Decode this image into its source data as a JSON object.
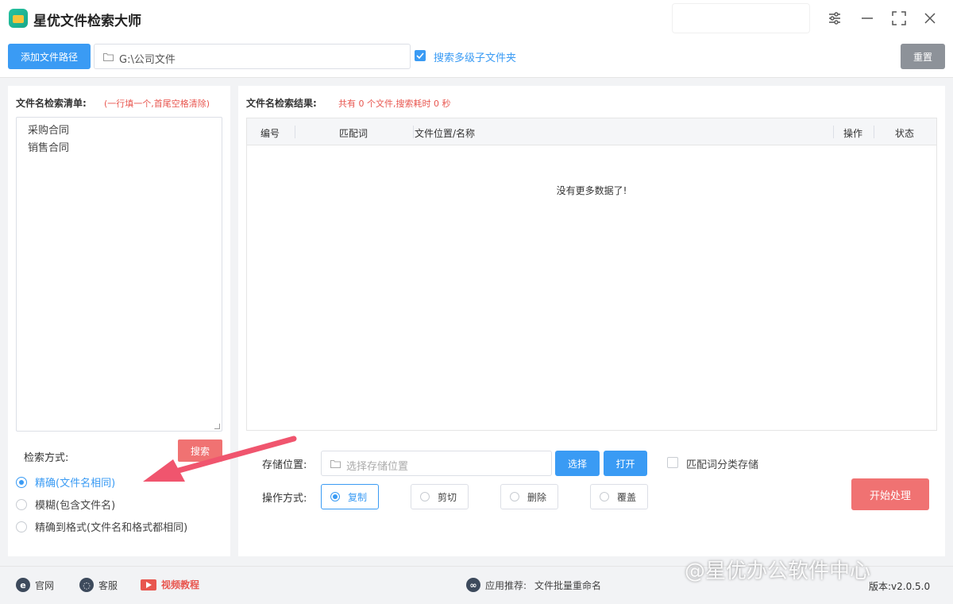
{
  "app": {
    "title": "星优文件检索大师"
  },
  "toolbar": {
    "add_path_label": "添加文件路径",
    "path_value": "G:\\公司文件",
    "subfolder_checked": true,
    "subfolder_label": "搜索多级子文件夹",
    "reset_label": "重置"
  },
  "left": {
    "list_title": "文件名检索清单:",
    "list_hint": "(一行填一个,首尾空格清除)",
    "keywords": [
      "采购合同",
      "销售合同"
    ],
    "mode_title": "检索方式:",
    "search_label": "搜索",
    "modes": [
      {
        "label": "精确(文件名相同)",
        "selected": true
      },
      {
        "label": "模糊(包含文件名)",
        "selected": false
      },
      {
        "label": "精确到格式(文件名和格式都相同)",
        "selected": false
      }
    ]
  },
  "results": {
    "title": "文件名检索结果:",
    "summary": "共有 0 个文件,搜索耗时 0 秒",
    "columns": [
      "编号",
      "匹配词",
      "文件位置/名称",
      "操作",
      "状态"
    ],
    "empty_message": "没有更多数据了!"
  },
  "processing": {
    "storage_label": "存储位置:",
    "storage_placeholder": "选择存储位置",
    "choose_label": "选择",
    "open_label": "打开",
    "classify_label": "匹配词分类存储",
    "classify_checked": false,
    "operation_label": "操作方式:",
    "operations": [
      {
        "label": "复制",
        "selected": true
      },
      {
        "label": "剪切",
        "selected": false
      },
      {
        "label": "删除",
        "selected": false
      },
      {
        "label": "覆盖",
        "selected": false
      }
    ],
    "start_label": "开始处理"
  },
  "footer": {
    "website_label": "官网",
    "service_label": "客服",
    "video_label": "视频教程",
    "recommend_prefix": "应用推荐:",
    "recommend_app": "文件批量重命名",
    "watermark": "@星优办公软件中心",
    "version": "版本:v2.0.5.0"
  },
  "colors": {
    "accent": "#3a9bf4",
    "danger": "#f07272",
    "hint": "#e8564f"
  }
}
